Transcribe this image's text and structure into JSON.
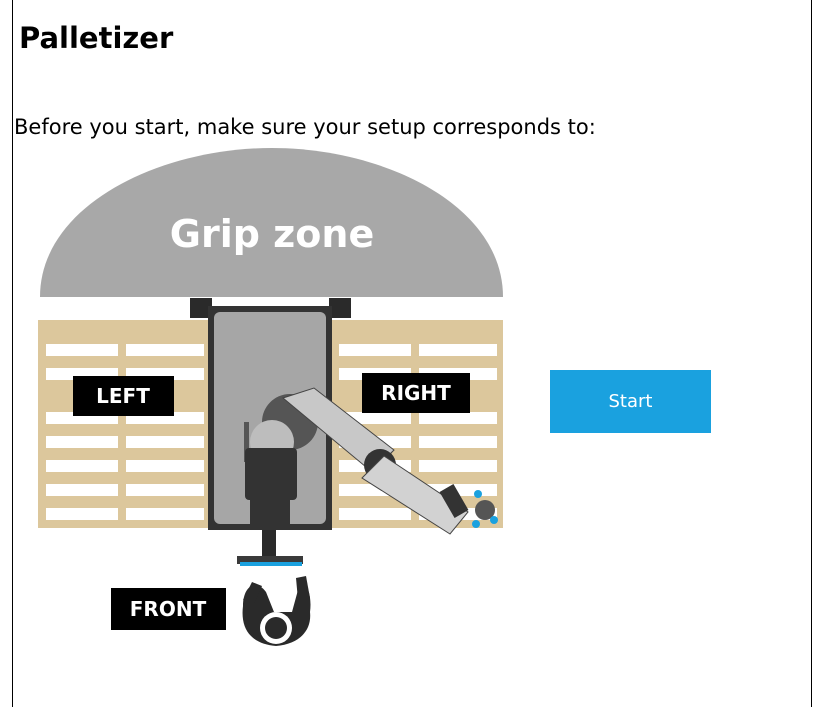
{
  "title": "Palletizer",
  "instruction": "Before you start, make sure your setup corresponds to:",
  "diagram": {
    "grip_zone_label": "Grip zone",
    "left_label": "LEFT",
    "right_label": "RIGHT",
    "front_label": "FRONT"
  },
  "start_button": {
    "label": "Start"
  },
  "colors": {
    "grip_zone": "#a8a8a8",
    "pallet": "#dcc79c",
    "pallet_slat": "#ffffff",
    "label_bg": "#000000",
    "accent": "#1aa1df"
  }
}
